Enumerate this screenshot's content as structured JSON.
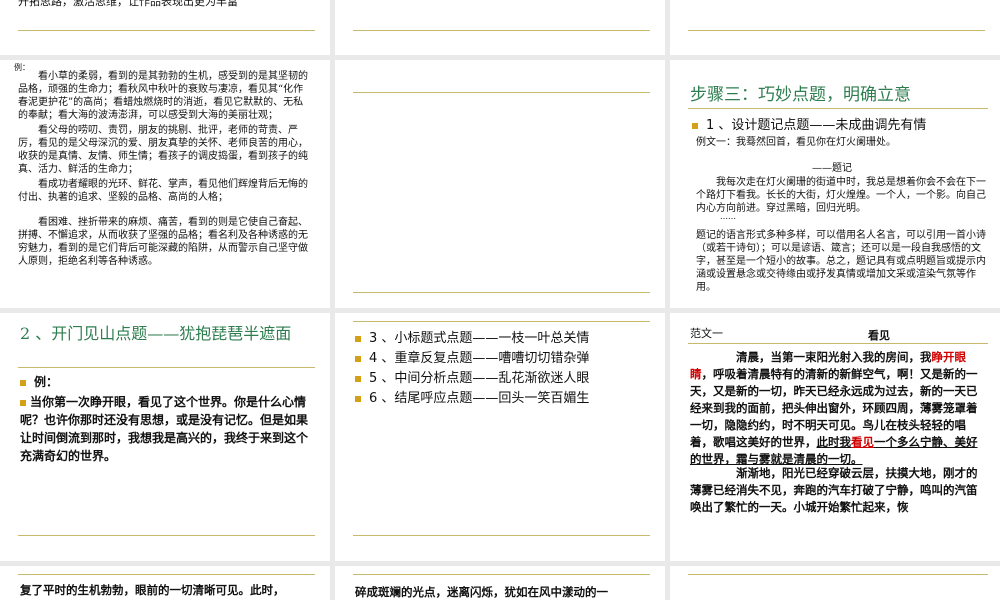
{
  "slides": {
    "s1": {
      "top_text": "开拓思路，激活思维，让作品表现出更为丰富"
    },
    "s4": {
      "label": "例：",
      "paragraphs": [
        "看小草的柔弱，看到的是其勃勃的生机，感受到的是其坚韧的品格，顽强的生命力；看秋风中秋叶的衰败与凄凉，看见其“化作春泥更护花”的高尚；看蜡烛燃烧时的消逝，看见它默默的、无私的奉献；看大海的波涛澎湃，可以感受到大海的美丽壮观；",
        "看父母的唠叨、责罚，朋友的挑剔、批评，老师的苛责、严厉，看见的是父母深沉的爱、朋友真挚的关怀、老师良苦的用心，收获的是真情、友情、师生情；看孩子的调皮捣蛋，看到孩子的纯真、活力、鲜活的生命力；",
        "看成功者耀眼的光环、鲜花、掌声，看见他们辉煌背后无悔的付出、执著的追求、坚毅的品格、高尚的人格；",
        "看困难、挫折带来的麻烦、痛苦，看到的则是它使自己奋起、拼搏、不懈追求，从而收获了坚强的品格；看名利及各种诱惑的无穷魅力，看到的是它们背后可能深藏的陷阱，从而警示自己坚守做人原则，拒绝名利等各种诱惑。"
      ]
    },
    "s6": {
      "title": "步骤三：巧妙点题，明确立意",
      "bullet": "1 、设计题记点题——未成曲调先有情",
      "example": "例文一：我蓦然回首，看见你在灯火阑珊处。",
      "tiji_label": "——题记",
      "tiji_text": "我每次走在灯火阑珊的街道中时，我总是想着你会不会在下一个路灯下看我。长长的大街，灯火煌煌。一个人，一个影。向自己内心方向前进。穿过黑暗，回归光明。",
      "ellipsis": "……",
      "note": "题记的语言形式多种多样，可以借用名人名言，可以引用一首小诗（或若干诗句）；可以是谚语、箴言；还可以是一段自我感悟的文字，甚至是一个短小的故事。总之，题记具有或点明题旨或提示内涵或设置悬念或交待缘由或抒发真情或增加文采或渲染气氛等作用。"
    },
    "s7": {
      "title": "2 、开门见山点题——犹抱琵琶半遮面",
      "label": "例：",
      "text": "当你第一次睁开眼，看见了这个世界。你是什么心情呢？也许你那时还没有思想，或是没有记忆。但是如果让时间倒流到那时，我想我是高兴的，我终于来到这个充满奇幻的世界。"
    },
    "s8": {
      "items": [
        "3 、小标题式点题——一枝一叶总关情",
        "4 、重章反复点题——嘈嘈切切错杂弹",
        "5 、中间分析点题——乱花渐欲迷人眼",
        "6 、结尾呼应点题——回头一笑百媚生"
      ]
    },
    "s9": {
      "label": "范文一",
      "title": "看见",
      "p1_a": "清晨，当第一束阳光射入我的房间，我",
      "p1_red1": "睁开眼睛",
      "p1_b": "，呼吸着清晨特有的清新的新鲜空气，啊！又是新的一天，又是新的一切，昨天已经永远成为过去，新的一天已经来到我的面前，把头伸出窗外，环顾四周，薄雾笼罩着一切，隐隐约约，时不明天可见。鸟儿在枝头轻轻的唱着，歌唱这美好的世界，",
      "p1_ul1": "此时我",
      "p1_red2": "看见",
      "p1_ul2": "一个多么宁静、美好的世界，霜与雾就是清晨的一切。",
      "p2": "渐渐地，阳光已经穿破云层，扶摸大地，刚才的薄雾已经消失不见，奔跑的汽车打破了宁静，鸣叫的汽笛唤出了繁忙的一天。小城开始繁忙起来，恢"
    },
    "s10": {
      "text": "复了平时的生机勃勃，眼前的一切清晰可见。此时，"
    },
    "s11": {
      "text": "碎成斑斓的光点，迷离闪烁，犹如在风中漾动的一"
    }
  }
}
